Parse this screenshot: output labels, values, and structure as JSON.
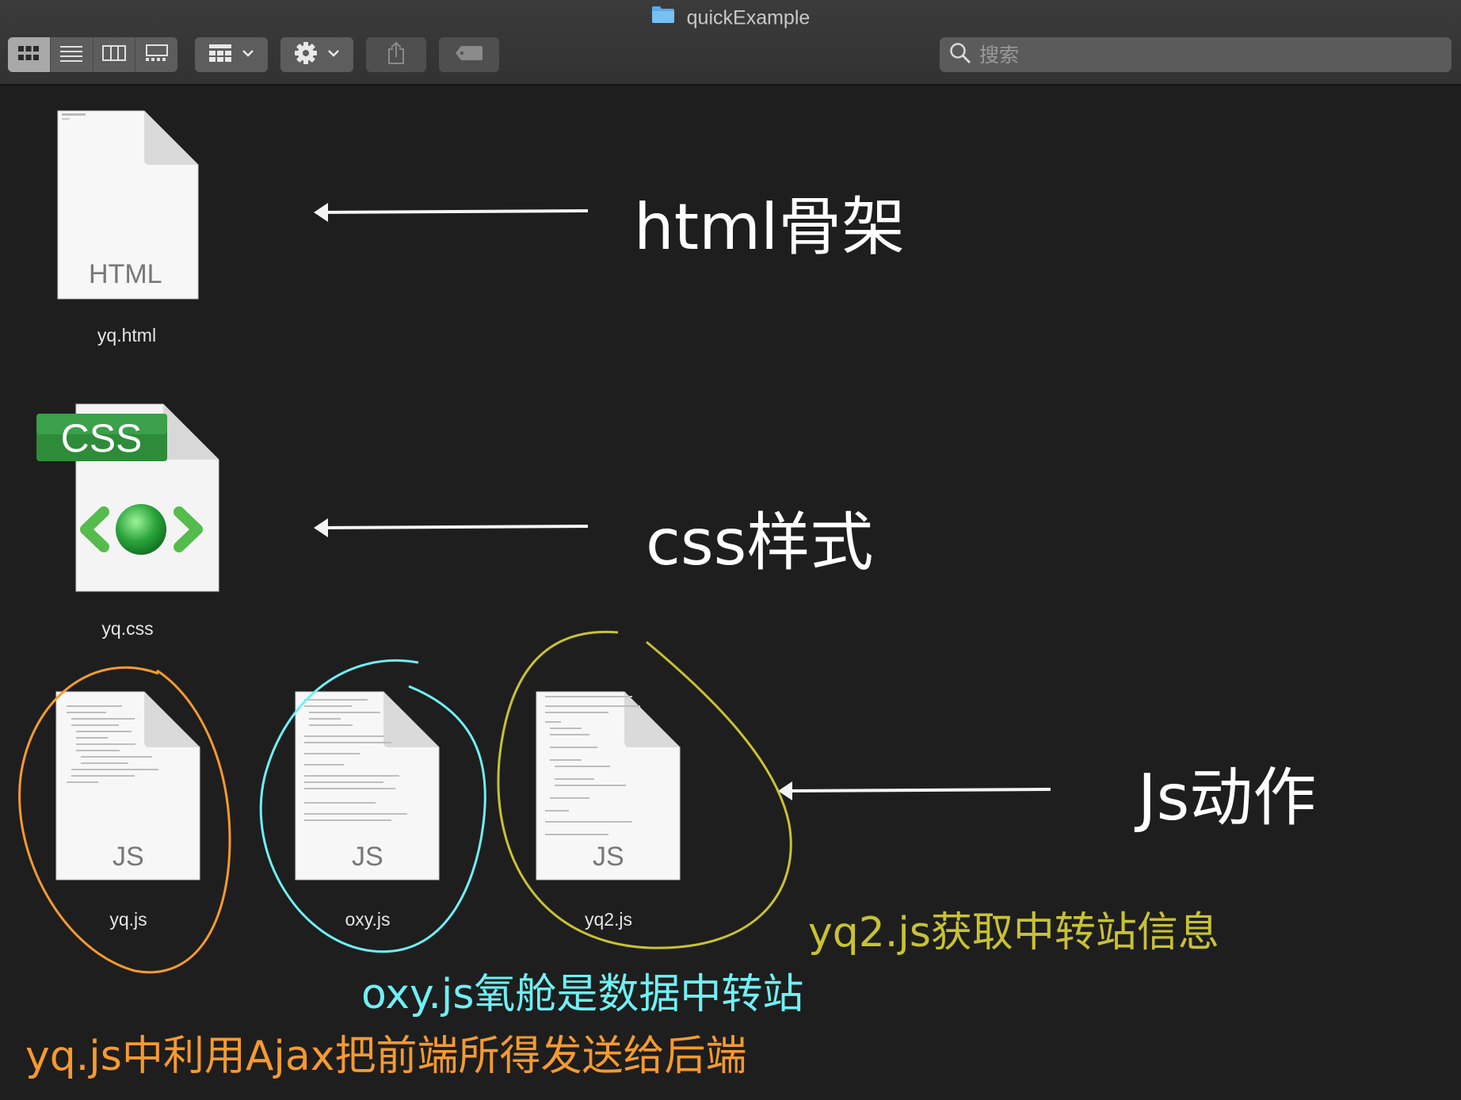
{
  "window": {
    "title": "quickExample"
  },
  "toolbar": {
    "view_buttons": [
      {
        "name": "icon-view",
        "icon": "grid-icon",
        "active": true
      },
      {
        "name": "list-view",
        "icon": "list-icon",
        "active": false
      },
      {
        "name": "column-view",
        "icon": "columns-icon",
        "active": false
      },
      {
        "name": "gallery-view",
        "icon": "gallery-icon",
        "active": false
      }
    ],
    "group_icon": "group-by-icon",
    "action_icon": "gear-icon",
    "share_icon": "share-icon",
    "tag_icon": "tag-icon",
    "search": {
      "placeholder": "搜索",
      "value": ""
    }
  },
  "files": [
    {
      "name": "yq.html",
      "type": "HTML"
    },
    {
      "name": "yq.css",
      "type": "CSS"
    },
    {
      "name": "yq.js",
      "type": "JS"
    },
    {
      "name": "oxy.js",
      "type": "JS"
    },
    {
      "name": "yq2.js",
      "type": "JS"
    }
  ],
  "annotations": {
    "html_note": "html骨架",
    "css_note": "css样式",
    "js_note": "Js动作",
    "yq2_note": "yq2.js获取中转站信息",
    "oxy_note": "oxy.js氧舱是数据中转站",
    "yq_note": "yq.js中利用Ajax把前端所得发送给后端"
  },
  "colors": {
    "background": "#1e1e1e",
    "annotation_white": "#ffffff",
    "annotation_yellow": "#c8c234",
    "annotation_cyan": "#6ff0f4",
    "annotation_orange": "#f59a30",
    "css_badge_green": "#2e8b3a"
  }
}
